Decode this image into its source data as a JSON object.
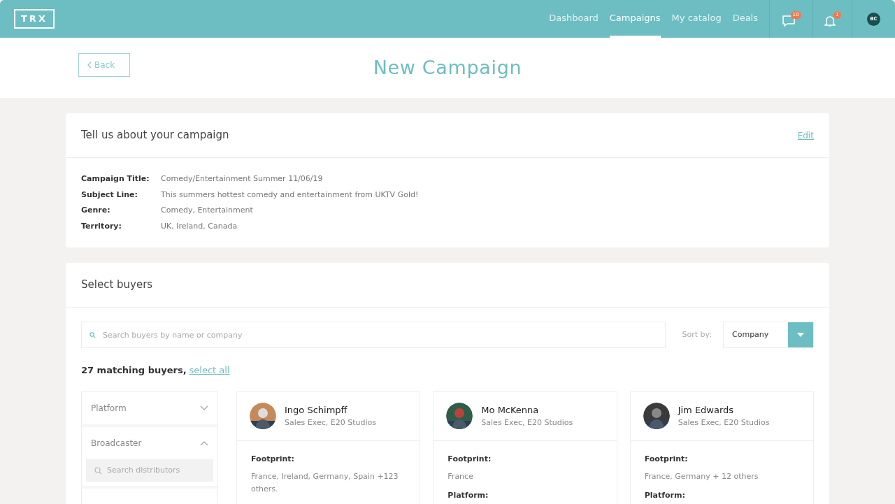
{
  "logo": "TRX",
  "nav": [
    {
      "label": "Dashboard",
      "selected": false
    },
    {
      "label": "Campaigns",
      "selected": true
    },
    {
      "label": "My catalog",
      "selected": false
    },
    {
      "label": "Deals",
      "selected": false
    }
  ],
  "messages_badge": "10",
  "notifications_badge": "1",
  "user_initials": "BC",
  "back_button": "Back",
  "page_title": "New Campaign",
  "campaign": {
    "title": "Tell us about your campaign",
    "edit": "Edit",
    "fields": [
      {
        "label": "Campaign Title:",
        "value": "Comedy/Entertainment Summer 11/06/19"
      },
      {
        "label": "Subject Line:",
        "value": "This summers hottest comedy and entertainment from UKTV Gold!"
      },
      {
        "label": "Genre:",
        "value": "Comedy, Entertainment"
      },
      {
        "label": "Territory:",
        "value": "UK, Ireland, Canada"
      }
    ]
  },
  "buyers": {
    "title": "Select buyers",
    "search_placeholder": "Search buyers by name or company",
    "sort_label": "Sort by:",
    "sort_value": "Company",
    "count": "27 matching buyers,",
    "select_all": "select all",
    "filters": [
      {
        "label": "Platform",
        "expanded": false
      },
      {
        "label": "Broadcaster",
        "expanded": true,
        "search_placeholder": "Search distributors"
      }
    ],
    "cards": [
      {
        "name": "Ingo Schimpff",
        "role": "Sales Exec, E20 Studios",
        "footprint_label": "Footprint:",
        "footprint": "France, Ireland, Germany, Spain +123 others."
      },
      {
        "name": "Mo McKenna",
        "role": "Sales Exec, E20 Studios",
        "footprint_label": "Footprint:",
        "footprint": "France",
        "platform_label": "Platform:"
      },
      {
        "name": "Jim Edwards",
        "role": "Sales Exec, E20 Studios",
        "footprint_label": "Footprint:",
        "footprint": "France, Germany + 12 others",
        "platform_label": "Platform:"
      }
    ]
  }
}
